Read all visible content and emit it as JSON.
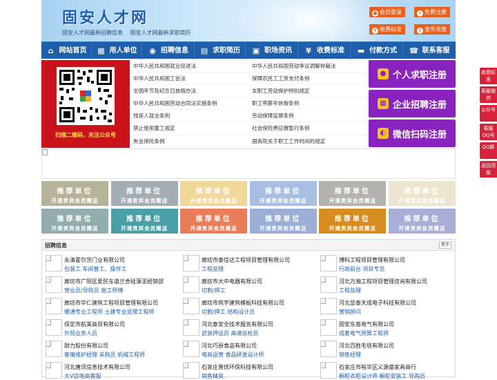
{
  "header": {
    "site_title": "固安人才网",
    "links": [
      "固安人才网最新招聘信息",
      "固安人才网最新求职简历"
    ],
    "buttons": [
      {
        "label": "会员登录",
        "icon": "user-icon"
      },
      {
        "label": "免费注册",
        "icon": "user-add-icon"
      },
      {
        "label": "收费标准",
        "icon": "yen-icon"
      },
      {
        "label": "金币充值",
        "icon": "coin-icon"
      }
    ]
  },
  "nav": [
    {
      "label": "网站首页",
      "icon": "home-icon"
    },
    {
      "label": "用人单位",
      "icon": "building-icon"
    },
    {
      "label": "招聘信息",
      "icon": "megaphone-icon"
    },
    {
      "label": "求职简历",
      "icon": "resume-icon"
    },
    {
      "label": "职场资讯",
      "icon": "news-icon"
    },
    {
      "label": "收费标准",
      "icon": "yen-icon"
    },
    {
      "label": "付款方式",
      "icon": "card-icon"
    },
    {
      "label": "联系客服",
      "icon": "phone-icon"
    }
  ],
  "qr": {
    "caption": "扫描二维码，关注公众号"
  },
  "laws": {
    "left": [
      "中华人民共和国就业促进法",
      "中华人民共和国工会法",
      "全国年节及纪念日放假办法",
      "中华人民共和国劳动合同法实施条例",
      "残疾人就业条例",
      "禁止使用童工规定",
      "失业保险条例"
    ],
    "right": [
      "中华人民共和国劳动争议调解仲裁法",
      "保障农民工工资支付条例",
      "女职工劳动保护特别规定",
      "职工带薪年休假条例",
      "劳动保障监察条例",
      "社会保险费征缴暂行条例",
      "国务院关于职工工作时间的规定"
    ]
  },
  "register": [
    {
      "label": "个人求职注册",
      "icon": "person-icon"
    },
    {
      "label": "企业招聘注册",
      "icon": "company-icon"
    },
    {
      "label": "微信扫码注册",
      "icon": "wechat-icon"
    }
  ],
  "recommend": {
    "title": "推荐单位",
    "subtitle": "开通贵宾会员赠送",
    "colors": [
      "#b7b39a",
      "#a4acb4",
      "#f0d79a",
      "#a8bfe1",
      "#b4b3b0",
      "#ede5cf",
      "#92adab",
      "#4a9fa7",
      "#ea7d57",
      "#9bafd6",
      "#d68c1e",
      "#a9aed6"
    ]
  },
  "jobs": {
    "title": "招聘信息",
    "more": "更多",
    "items": [
      {
        "company": "永清霍尔茨门业有限公司",
        "positions": "包装工 车间普工、操作工"
      },
      {
        "company": "廊坊市泰信达工程项目管理有限公司",
        "positions": "工程监理"
      },
      {
        "company": "博科工程项目管理有限公司",
        "positions": "行政前台 项目专员"
      },
      {
        "company": "廊坊市广阳区爱民东道兰舍硅藻泥经销部",
        "positions": "营业员/导购员 施工师傅"
      },
      {
        "company": "廊坊市大中电器有限公司",
        "positions": "切割/焊工"
      },
      {
        "company": "河北万瀚工程项目管理咨询有限公司",
        "positions": "工程监理"
      },
      {
        "company": "廊坊市华仁建筑工程项目管理有限公司",
        "positions": "暖通专业工程师 土建专业监理工程师"
      },
      {
        "company": "廊坊市筑宇建筑模板科技有限公司",
        "positions": "切割/焊工 结构设计员"
      },
      {
        "company": "河北显泰天成电子科技有限公司",
        "positions": "营销顾问"
      },
      {
        "company": "保定市航美商贸有限公司",
        "positions": "外贸业务人员"
      },
      {
        "company": "河北泰安全技术服务有限公司",
        "positions": "武装押运员 高速巡检员"
      },
      {
        "company": "固安东南电气有限公司",
        "positions": "成套电气预算工程师"
      },
      {
        "company": "耐力股份有限公司",
        "positions": "客情维护经理 采购员 机械工程师"
      },
      {
        "company": "河北巧厨食品有限公司",
        "positions": "电商运营 食品研发设计师"
      },
      {
        "company": "河北百胜毛毯有限公司",
        "positions": "销售经理"
      },
      {
        "company": "河北唐讯信息技术有限公司",
        "positions": "大V店电商客服"
      },
      {
        "company": "石家庄普优环保科技有限公司",
        "positions": "销售精英"
      },
      {
        "company": "石家庄市裕华区义源盛家具商行",
        "positions": "橱柜衣柜设计师 橱柜安装工 导购员"
      }
    ]
  },
  "float": [
    "收费标准",
    "客服微信",
    "公众号",
    "客服QQ号",
    "QQ群",
    "返回顶部"
  ]
}
